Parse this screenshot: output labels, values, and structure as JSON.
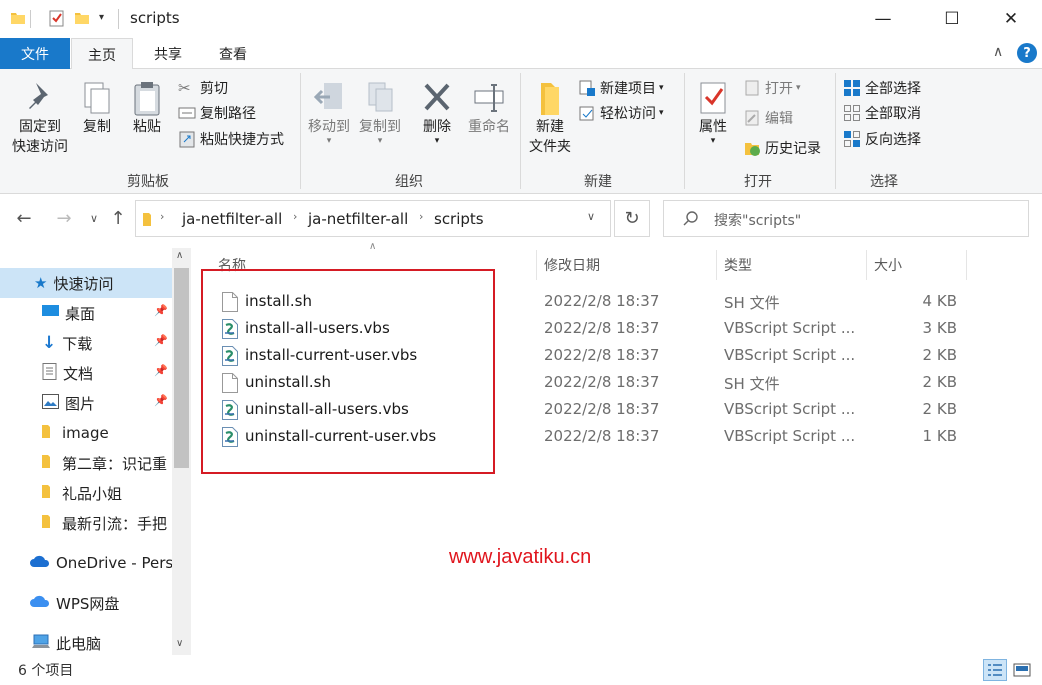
{
  "window": {
    "title": "scripts",
    "minimize": "—",
    "maximize": "☐",
    "close": "✕"
  },
  "ribbon_tabs": [
    "文件",
    "主页",
    "共享",
    "查看"
  ],
  "ribbon": {
    "clipboard": {
      "pin_line1": "固定到",
      "pin_line2": "快速访问",
      "copy": "复制",
      "paste": "粘贴",
      "cut": "剪切",
      "copy_path": "复制路径",
      "paste_shortcut": "粘贴快捷方式",
      "label": "剪贴板"
    },
    "organize": {
      "move_to": "移动到",
      "copy_to": "复制到",
      "delete": "删除",
      "rename": "重命名",
      "label": "组织"
    },
    "new": {
      "new_folder_line1": "新建",
      "new_folder_line2": "文件夹",
      "new_item": "新建项目",
      "easy_access": "轻松访问",
      "label": "新建"
    },
    "open": {
      "properties": "属性",
      "open": "打开",
      "edit": "编辑",
      "history": "历史记录",
      "label": "打开"
    },
    "select": {
      "select_all": "全部选择",
      "select_none": "全部取消",
      "invert": "反向选择",
      "label": "选择"
    }
  },
  "address": {
    "crumbs": [
      "ja-netfilter-all",
      "ja-netfilter-all",
      "scripts"
    ],
    "search_placeholder": "搜索\"scripts\""
  },
  "sidebar": {
    "items": [
      {
        "label": "快速访问",
        "icon": "star-icon"
      },
      {
        "label": "桌面",
        "icon": "desktop-icon",
        "pinned": true
      },
      {
        "label": "下载",
        "icon": "download-icon",
        "pinned": true
      },
      {
        "label": "文档",
        "icon": "document-icon",
        "pinned": true
      },
      {
        "label": "图片",
        "icon": "picture-icon",
        "pinned": true
      },
      {
        "label": "image",
        "icon": "folder-icon"
      },
      {
        "label": "第二章：识记重",
        "icon": "folder-icon"
      },
      {
        "label": "礼品小姐",
        "icon": "folder-icon"
      },
      {
        "label": "最新引流：手把",
        "icon": "folder-icon"
      },
      {
        "label": "OneDrive - Perso",
        "icon": "cloud-icon"
      },
      {
        "label": "WPS网盘",
        "icon": "cloud-icon"
      },
      {
        "label": "此电脑",
        "icon": "computer-icon"
      }
    ]
  },
  "columns": {
    "name": "名称",
    "date": "修改日期",
    "type": "类型",
    "size": "大小"
  },
  "files": [
    {
      "name": "install.sh",
      "date": "2022/2/8 18:37",
      "type": "SH 文件",
      "size": "4 KB",
      "kind": "plain"
    },
    {
      "name": "install-all-users.vbs",
      "date": "2022/2/8 18:37",
      "type": "VBScript Script ...",
      "size": "3 KB",
      "kind": "vbs"
    },
    {
      "name": "install-current-user.vbs",
      "date": "2022/2/8 18:37",
      "type": "VBScript Script ...",
      "size": "2 KB",
      "kind": "vbs"
    },
    {
      "name": "uninstall.sh",
      "date": "2022/2/8 18:37",
      "type": "SH 文件",
      "size": "2 KB",
      "kind": "plain"
    },
    {
      "name": "uninstall-all-users.vbs",
      "date": "2022/2/8 18:37",
      "type": "VBScript Script ...",
      "size": "2 KB",
      "kind": "vbs"
    },
    {
      "name": "uninstall-current-user.vbs",
      "date": "2022/2/8 18:37",
      "type": "VBScript Script ...",
      "size": "1 KB",
      "kind": "vbs"
    }
  ],
  "watermark": "www.javatiku.cn",
  "status": {
    "count": "6 个项目"
  },
  "colors": {
    "accent": "#1979ca",
    "highlight_box": "#d51b24",
    "selected_nav": "#cce4f7"
  }
}
